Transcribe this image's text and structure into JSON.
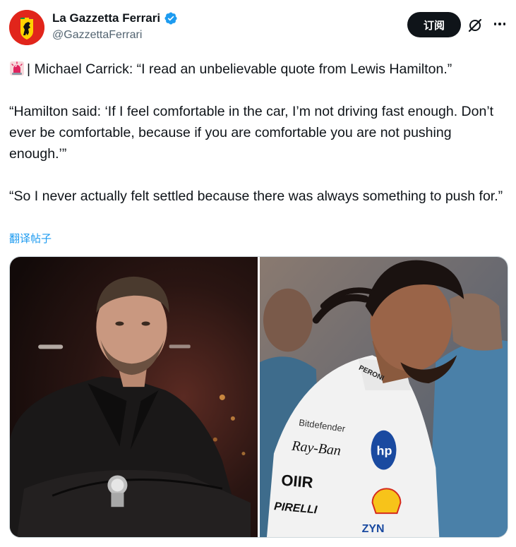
{
  "author": {
    "display_name": "La Gazzetta Ferrari",
    "handle": "@GazzettaFerrari",
    "verified": true,
    "avatar_icon": "ferrari-prancing-horse-logo"
  },
  "actions": {
    "subscribe_label": "订阅",
    "grok_icon": "grok-icon",
    "more_icon": "more-dots-icon"
  },
  "tweet": {
    "paragraphs": [
      "| Michael Carrick: “I read an unbelievable quote from Lewis Hamilton.”",
      "“Hamilton said: ‘If I feel comfortable in the car, I’m not driving fast enough. Don’t ever be comfortable, because if you are comfortable you are not pushing enough.’”",
      "“So I never actually felt settled because there was always something to push for.”"
    ],
    "leading_emoji_icon": "police-siren-icon",
    "translate_label": "翻译帖子"
  },
  "media": {
    "images": [
      {
        "alt": "Michael Carrick in black coat with arms crossed",
        "icon": "photo-carrick"
      },
      {
        "alt": "Lewis Hamilton in white Ferrari race suit looking down",
        "icon": "photo-hamilton"
      }
    ]
  },
  "colors": {
    "text": "#0f1419",
    "secondary": "#536471",
    "link": "#1d9bf0",
    "verified": "#1d9bf0",
    "avatar_red": "#e1251b"
  }
}
